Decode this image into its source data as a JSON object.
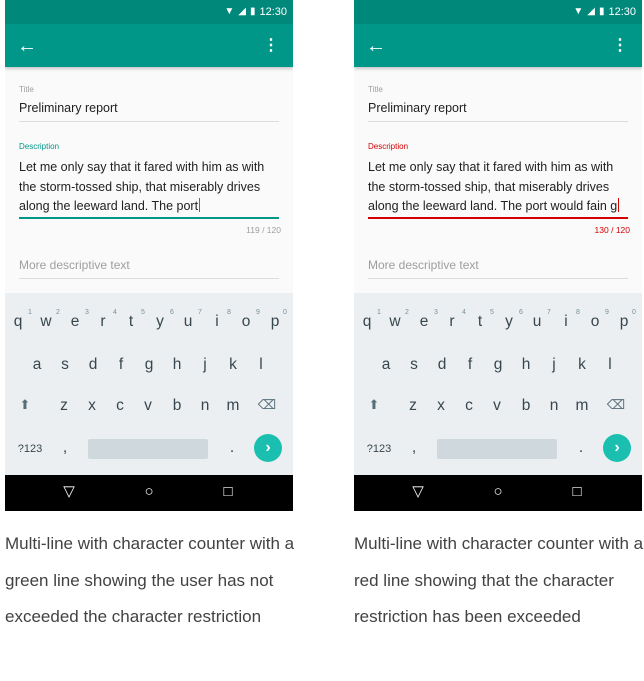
{
  "status_bar": {
    "time": "12:30"
  },
  "colors": {
    "teal": "#009688",
    "teal_dark": "#00897b",
    "error_red": "#d50000"
  },
  "screens": [
    {
      "title_label": "Title",
      "title_value": "Preliminary report",
      "description_label": "Description",
      "description_text": "Let me only say that it fared with him as with the storm-tossed ship, that miserably drives along the leeward land. The port",
      "counter": "119 / 120",
      "more_placeholder": "More descriptive text",
      "state": "valid",
      "caption": "Multi-line with character counter with a green line showing the user has not exceeded the character restriction"
    },
    {
      "title_label": "Title",
      "title_value": "Preliminary report",
      "description_label": "Description",
      "description_text": "Let me only say that it fared with him as with the storm-tossed ship, that miserably drives along the leeward land. The port would fain g",
      "counter": "130 / 120",
      "more_placeholder": "More descriptive text",
      "state": "error",
      "caption": "Multi-line with character counter with a red line showing that the character restriction has been exceeded"
    }
  ],
  "keyboard": {
    "row1": [
      "q",
      "w",
      "e",
      "r",
      "t",
      "y",
      "u",
      "i",
      "o",
      "p"
    ],
    "row1_numbers": [
      "1",
      "2",
      "3",
      "4",
      "5",
      "6",
      "7",
      "8",
      "9",
      "0"
    ],
    "row2": [
      "a",
      "s",
      "d",
      "f",
      "g",
      "h",
      "j",
      "k",
      "l"
    ],
    "row3": [
      "z",
      "x",
      "c",
      "v",
      "b",
      "n",
      "m"
    ],
    "symbols_key": "?123",
    "comma_key": ",",
    "period_key": ".",
    "shift_icon": "shift-icon",
    "backspace_icon": "backspace-icon",
    "enter_icon": "chevron-right-icon"
  },
  "icons": {
    "back": "arrow-back-icon",
    "overflow": "more-vert-icon",
    "nav_back": "nav-back-triangle-icon",
    "nav_home": "nav-home-circle-icon",
    "nav_recents": "nav-recents-square-icon"
  }
}
